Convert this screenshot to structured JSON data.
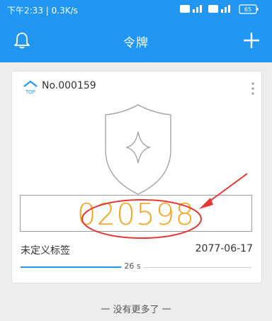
{
  "status_bar": {
    "left": "下午2:33 | 0.3K/s",
    "battery": "65"
  },
  "app_bar": {
    "title": "令牌"
  },
  "token": {
    "serial": "No.000159",
    "code": "020598",
    "label": "未定义标签",
    "expiry": "2077-06-17",
    "seconds_remaining_text": "26 s",
    "seconds_remaining": 26,
    "period": 30
  },
  "footer": {
    "no_more": "一 没有更多了 一"
  },
  "colors": {
    "primary": "#2196f3",
    "code": "#f5a623",
    "annotation": "#e53935"
  },
  "icons": [
    "bell-icon",
    "plus-icon",
    "top-icon",
    "more-vert-icon",
    "shield-icon"
  ]
}
